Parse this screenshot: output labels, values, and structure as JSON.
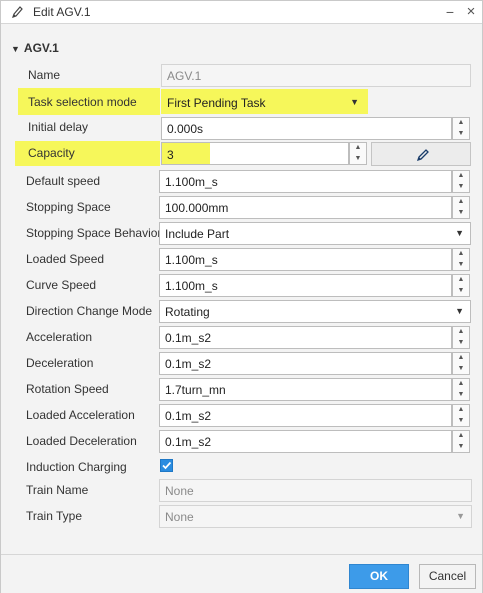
{
  "window": {
    "title": "Edit AGV.1",
    "minimize_glyph": "−",
    "close_glyph": "×"
  },
  "section": {
    "title": "AGV.1"
  },
  "fields": {
    "name": {
      "label": "Name",
      "value": "AGV.1"
    },
    "task_selection_mode": {
      "label": "Task selection mode",
      "value": "First Pending Task"
    },
    "initial_delay": {
      "label": "Initial delay",
      "value": "0.000s"
    },
    "capacity": {
      "label": "Capacity",
      "value": "3"
    },
    "default_speed": {
      "label": "Default speed",
      "value": "1.100m_s"
    },
    "stopping_space": {
      "label": "Stopping Space",
      "value": "100.000mm"
    },
    "stopping_space_behavior": {
      "label": "Stopping Space Behavior",
      "value": "Include Part"
    },
    "loaded_speed": {
      "label": "Loaded Speed",
      "value": "1.100m_s"
    },
    "curve_speed": {
      "label": "Curve Speed",
      "value": "1.100m_s"
    },
    "direction_change_mode": {
      "label": "Direction Change Mode",
      "value": "Rotating"
    },
    "acceleration": {
      "label": "Acceleration",
      "value": "0.1m_s2"
    },
    "deceleration": {
      "label": "Deceleration",
      "value": "0.1m_s2"
    },
    "rotation_speed": {
      "label": "Rotation Speed",
      "value": "1.7turn_mn"
    },
    "loaded_acceleration": {
      "label": "Loaded Acceleration",
      "value": "0.1m_s2"
    },
    "loaded_deceleration": {
      "label": "Loaded Deceleration",
      "value": "0.1m_s2"
    },
    "induction_charging": {
      "label": "Induction Charging",
      "checked": true
    },
    "train_name": {
      "label": "Train Name",
      "value": "None"
    },
    "train_type": {
      "label": "Train Type",
      "value": "None"
    }
  },
  "buttons": {
    "ok": "OK",
    "cancel": "Cancel"
  },
  "colors": {
    "highlight": "#f6f75a",
    "accent": "#3d9be9"
  }
}
